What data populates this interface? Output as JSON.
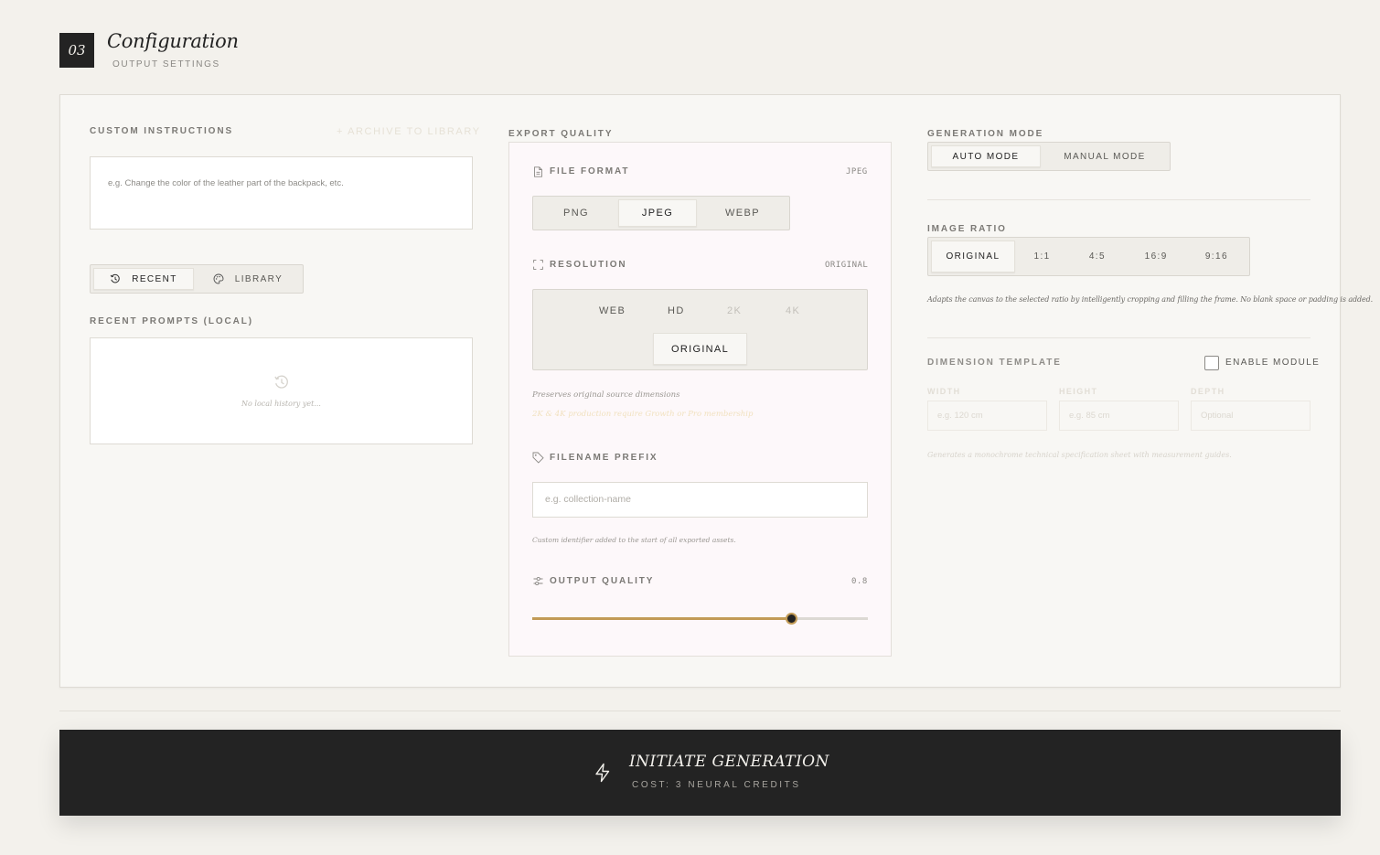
{
  "header": {
    "section_number": "03",
    "title": "Configuration",
    "subtitle": "OUTPUT SETTINGS"
  },
  "instructions": {
    "label": "CUSTOM INSTRUCTIONS",
    "archive_label": "+ ARCHIVE TO LIBRARY",
    "placeholder": "e.g. Change the color of the leather part of the backpack, etc."
  },
  "history_tabs": [
    {
      "label": "RECENT",
      "icon": "history-icon",
      "active": true
    },
    {
      "label": "LIBRARY",
      "icon": "palette-icon",
      "active": false
    }
  ],
  "recent_prompts": {
    "label": "RECENT PROMPTS (LOCAL)",
    "empty_text": "No local history yet..."
  },
  "export_quality": {
    "label": "EXPORT QUALITY",
    "file_format": {
      "label": "FILE FORMAT",
      "value": "JPEG",
      "options": [
        "PNG",
        "JPEG",
        "WEBP"
      ],
      "selected": "JPEG"
    },
    "resolution": {
      "label": "RESOLUTION",
      "value": "ORIGINAL",
      "options": [
        "WEB",
        "HD",
        "2K",
        "4K"
      ],
      "disabled_options": [
        "2K",
        "4K"
      ],
      "original_label": "ORIGINAL",
      "note": "Preserves original source dimensions",
      "upsell": "2K & 4K production require Growth or Pro membership"
    },
    "filename_prefix": {
      "label": "FILENAME PREFIX",
      "placeholder": "e.g. collection-name",
      "note": "Custom identifier added to the start of all exported assets."
    },
    "output_quality": {
      "label": "OUTPUT QUALITY",
      "value": "0.8",
      "level": 0.77
    }
  },
  "generation_mode": {
    "label": "GENERATION MODE",
    "options": [
      "AUTO MODE",
      "MANUAL MODE"
    ],
    "selected": "AUTO MODE"
  },
  "image_ratio": {
    "label": "IMAGE RATIO",
    "options": [
      "ORIGINAL",
      "1:1",
      "4:5",
      "16:9",
      "9:16"
    ],
    "selected": "ORIGINAL",
    "note": "Adapts the canvas to the selected ratio by intelligently cropping and filling the frame. No blank space or padding is added."
  },
  "dimension_template": {
    "label": "DIMENSION TEMPLATE",
    "enable_label": "ENABLE MODULE",
    "enabled": false,
    "fields": [
      {
        "label": "WIDTH",
        "placeholder": "e.g. 120 cm"
      },
      {
        "label": "HEIGHT",
        "placeholder": "e.g. 85 cm"
      },
      {
        "label": "DEPTH",
        "placeholder": "Optional"
      }
    ],
    "note": "Generates a monochrome technical specification sheet with measurement guides."
  },
  "cta": {
    "title": "INITIATE GENERATION",
    "subtitle": "COST: 3 NEURAL CREDITS"
  },
  "colors": {
    "accent": "#c29b56",
    "dark": "#232323",
    "background": "#f3f1ec"
  }
}
